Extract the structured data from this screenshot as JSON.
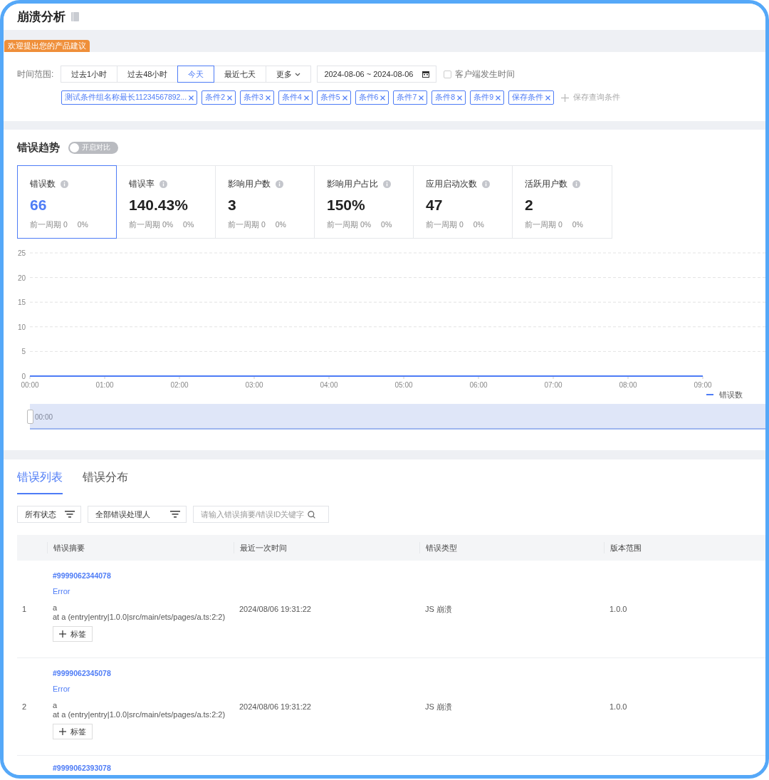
{
  "page": {
    "title": "崩溃分析"
  },
  "banner": {
    "label": "欢迎提出您的产品建议"
  },
  "filters": {
    "time_label": "时间范围:",
    "ranges": [
      {
        "label": "过去1小时",
        "kind": "option",
        "selected": false
      },
      {
        "label": "过去48小时",
        "kind": "option",
        "selected": false
      },
      {
        "label": "今天",
        "kind": "option",
        "selected": true
      },
      {
        "label": "最近七天",
        "kind": "option",
        "selected": false
      },
      {
        "label": "更多",
        "kind": "dropdown",
        "selected": false
      }
    ],
    "date_range": "2024-08-06 ~ 2024-08-06",
    "client_time": {
      "label": "客户端发生时间",
      "checked": false
    },
    "tags": [
      "测试条件组名称最长11234567892...",
      "条件2",
      "条件3",
      "条件4",
      "条件5",
      "条件6",
      "条件7",
      "条件8",
      "条件9",
      "保存条件"
    ],
    "save_query": "保存查询条件"
  },
  "trend": {
    "title": "错误趋势",
    "compare_toggle": {
      "label": "开启对比",
      "on": false
    },
    "metrics": [
      {
        "label": "错误数",
        "value": "66",
        "previous": "前一周期 0",
        "change": "0%",
        "selected": true
      },
      {
        "label": "错误率",
        "value": "140.43%",
        "previous": "前一周期 0%",
        "change": "0%",
        "selected": false
      },
      {
        "label": "影响用户数",
        "value": "3",
        "previous": "前一周期 0",
        "change": "0%",
        "selected": false
      },
      {
        "label": "影响用户占比",
        "value": "150%",
        "previous": "前一周期 0%",
        "change": "0%",
        "selected": false
      },
      {
        "label": "应用启动次数",
        "value": "47",
        "previous": "前一周期 0",
        "change": "0%",
        "selected": false
      },
      {
        "label": "活跃用户数",
        "value": "2",
        "previous": "前一周期 0",
        "change": "0%",
        "selected": false
      }
    ],
    "chart": {
      "chart_data": {
        "type": "line",
        "categories": [
          "00:00",
          "01:00",
          "02:00",
          "03:00",
          "04:00",
          "05:00",
          "06:00",
          "07:00",
          "08:00",
          "09:00"
        ],
        "series": [
          {
            "name": "错误数",
            "color": "#4e7cf6",
            "values": [
              0,
              0,
              0,
              0,
              0,
              0,
              0,
              0,
              0,
              0
            ]
          }
        ],
        "ylim": [
          0,
          25
        ],
        "yticks": [
          0,
          5,
          10,
          15,
          20,
          25
        ],
        "grid": true
      },
      "zoom_label": "00:00",
      "zoom": {
        "level": 1
      }
    }
  },
  "list": {
    "tabs": [
      {
        "label": "错误列表",
        "selected": true
      },
      {
        "label": "错误分布",
        "selected": false
      }
    ],
    "status_filter": "所有状态",
    "handler_filter": "全部错误处理人",
    "search": {
      "placeholder": "请输入错误摘要/错误ID关键字"
    },
    "table": {
      "columns": [
        "错误摘要",
        "最近一次时间",
        "错误类型",
        "版本范围"
      ],
      "rows": [
        {
          "index": "1",
          "id": "#9999062344078",
          "name": "Error",
          "message": "a",
          "stack": "at a (entry|entry|1.0.0|src/main/ets/pages/a.ts:2:2)",
          "tag_button": "标签",
          "last_time": "2024/08/06 19:31:22",
          "type": "JS 崩溃",
          "version": "1.0.0"
        },
        {
          "index": "2",
          "id": "#9999062345078",
          "name": "Error",
          "message": "a",
          "stack": "at a (entry|entry|1.0.0|src/main/ets/pages/a.ts:2:2)",
          "tag_button": "标签",
          "last_time": "2024/08/06 19:31:22",
          "type": "JS 崩溃",
          "version": "1.0.0"
        },
        {
          "id": "#9999062393078"
        }
      ]
    }
  }
}
